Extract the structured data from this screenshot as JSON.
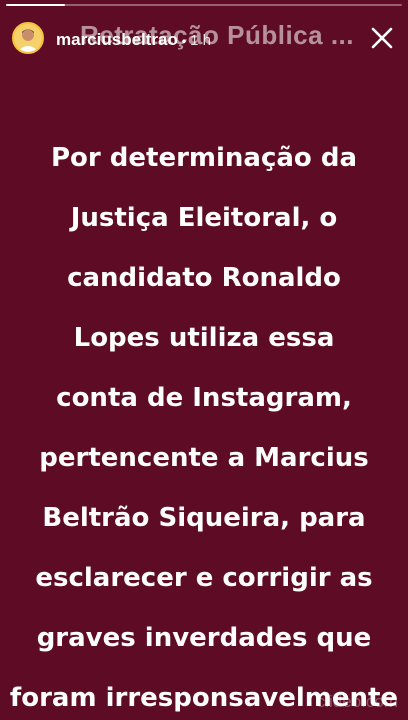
{
  "story": {
    "caption": "Retratação Pública ...",
    "username": "marciusbeltrao",
    "time": "1 h",
    "progress": 0.15
  },
  "body_lines": [
    "Por determinação da",
    "Justiça Eleitoral, o",
    "candidato Ronaldo",
    "Lopes utiliza essa",
    "conta de Instagram,",
    "pertencente a Marcius",
    "Beltrão Siqueira, para",
    "esclarecer e corrigir as",
    "graves inverdades que",
    "foram irresponsavelmente"
  ],
  "watermark": "clideo.com",
  "colors": {
    "background": "#5e0b25",
    "text": "#ffffff",
    "avatar_ring": "#f4c33a"
  },
  "icons": {
    "close": "close-icon"
  }
}
